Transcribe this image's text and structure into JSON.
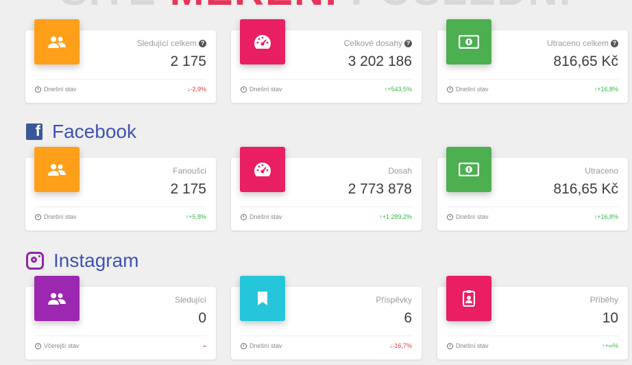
{
  "banner": {
    "left": "SITE",
    "accent": "MERENI",
    "right": "POSLEDNÍ"
  },
  "summary": {
    "cards": [
      {
        "label": "Sledující celkem",
        "value": "2 175",
        "footer": "Dnešní stav",
        "change": "-2,9%",
        "trend": "down",
        "icon": "people-icon",
        "color": "#ff9f1a"
      },
      {
        "label": "Celkové dosahy",
        "value": "3 202 186",
        "footer": "Dnešní stav",
        "change": "+543,5%",
        "trend": "up",
        "icon": "speedometer-icon",
        "color": "#e91e63"
      },
      {
        "label": "Utraceno celkem",
        "value": "816,65 Kč",
        "footer": "Dnešní stav",
        "change": "+16,8%",
        "trend": "up",
        "icon": "money-icon",
        "color": "#4caf50"
      }
    ]
  },
  "facebook": {
    "title": "Facebook",
    "cards": [
      {
        "label": "Fanoušci",
        "value": "2 175",
        "footer": "Dnešní stav",
        "change": "+5,8%",
        "trend": "up",
        "icon": "people-icon",
        "color": "#ff9f1a"
      },
      {
        "label": "Dosah",
        "value": "2 773 878",
        "footer": "Dnešní stav",
        "change": "+1 289,2%",
        "trend": "up",
        "icon": "speedometer-icon",
        "color": "#e91e63"
      },
      {
        "label": "Utraceno",
        "value": "816,65 Kč",
        "footer": "Dnešní stav",
        "change": "+16,8%",
        "trend": "up",
        "icon": "money-icon",
        "color": "#4caf50"
      }
    ]
  },
  "instagram": {
    "title": "Instagram",
    "cards": [
      {
        "label": "Sledující",
        "value": "0",
        "footer": "Včerejší stav",
        "change": "–",
        "trend": "neutral",
        "icon": "people-icon",
        "color": "#9c27b0"
      },
      {
        "label": "Příspěvky",
        "value": "6",
        "footer": "Dnešní stav",
        "change": "-16,7%",
        "trend": "down",
        "icon": "bookmark-icon",
        "color": "#26c6da"
      },
      {
        "label": "Příběhy",
        "value": "10",
        "footer": "Dnešní stav",
        "change": "+∞%",
        "trend": "up",
        "icon": "badge-icon",
        "color": "#e91e63"
      }
    ]
  }
}
